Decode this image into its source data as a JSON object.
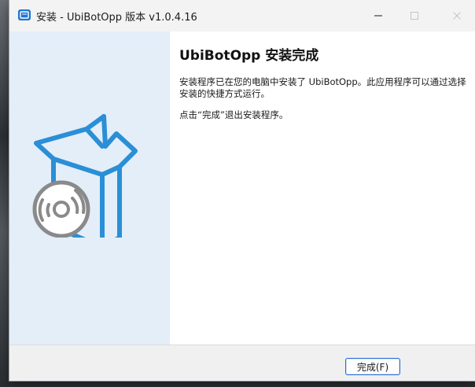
{
  "window": {
    "title": "安装 - UbiBotOpp 版本 v1.0.4.16",
    "controls": {
      "minimize": "–",
      "maximize": "□",
      "close": "✕"
    }
  },
  "page": {
    "heading": "UbiBotOpp 安装完成",
    "paragraph_1": "安装程序已在您的电脑中安装了 UbiBotOpp。此应用程序可以通过选择安装的快捷方式运行。",
    "paragraph_2": "点击“完成”退出安装程序。"
  },
  "footer": {
    "finish_label": "完成(F)"
  },
  "colors": {
    "sidebar": "#e3eef9",
    "accent": "#1f76d2",
    "graphic_stroke": "#2a8fd6",
    "disc_stroke": "#8a8a8a"
  },
  "icons": {
    "app": "installer-icon",
    "graphic": "software-box-with-disc"
  }
}
